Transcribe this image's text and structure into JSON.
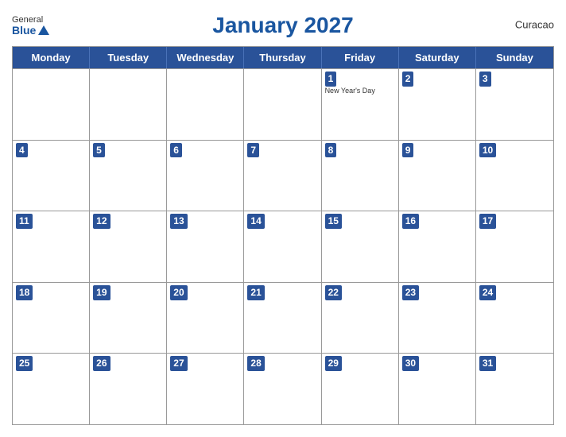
{
  "header": {
    "logo_general": "General",
    "logo_blue": "Blue",
    "title": "January 2027",
    "region": "Curacao"
  },
  "days_of_week": [
    "Monday",
    "Tuesday",
    "Wednesday",
    "Thursday",
    "Friday",
    "Saturday",
    "Sunday"
  ],
  "weeks": [
    [
      {
        "date": "",
        "event": ""
      },
      {
        "date": "",
        "event": ""
      },
      {
        "date": "",
        "event": ""
      },
      {
        "date": "",
        "event": ""
      },
      {
        "date": "1",
        "event": "New Year's Day"
      },
      {
        "date": "2",
        "event": ""
      },
      {
        "date": "3",
        "event": ""
      }
    ],
    [
      {
        "date": "4",
        "event": ""
      },
      {
        "date": "5",
        "event": ""
      },
      {
        "date": "6",
        "event": ""
      },
      {
        "date": "7",
        "event": ""
      },
      {
        "date": "8",
        "event": ""
      },
      {
        "date": "9",
        "event": ""
      },
      {
        "date": "10",
        "event": ""
      }
    ],
    [
      {
        "date": "11",
        "event": ""
      },
      {
        "date": "12",
        "event": ""
      },
      {
        "date": "13",
        "event": ""
      },
      {
        "date": "14",
        "event": ""
      },
      {
        "date": "15",
        "event": ""
      },
      {
        "date": "16",
        "event": ""
      },
      {
        "date": "17",
        "event": ""
      }
    ],
    [
      {
        "date": "18",
        "event": ""
      },
      {
        "date": "19",
        "event": ""
      },
      {
        "date": "20",
        "event": ""
      },
      {
        "date": "21",
        "event": ""
      },
      {
        "date": "22",
        "event": ""
      },
      {
        "date": "23",
        "event": ""
      },
      {
        "date": "24",
        "event": ""
      }
    ],
    [
      {
        "date": "25",
        "event": ""
      },
      {
        "date": "26",
        "event": ""
      },
      {
        "date": "27",
        "event": ""
      },
      {
        "date": "28",
        "event": ""
      },
      {
        "date": "29",
        "event": ""
      },
      {
        "date": "30",
        "event": ""
      },
      {
        "date": "31",
        "event": ""
      }
    ]
  ]
}
